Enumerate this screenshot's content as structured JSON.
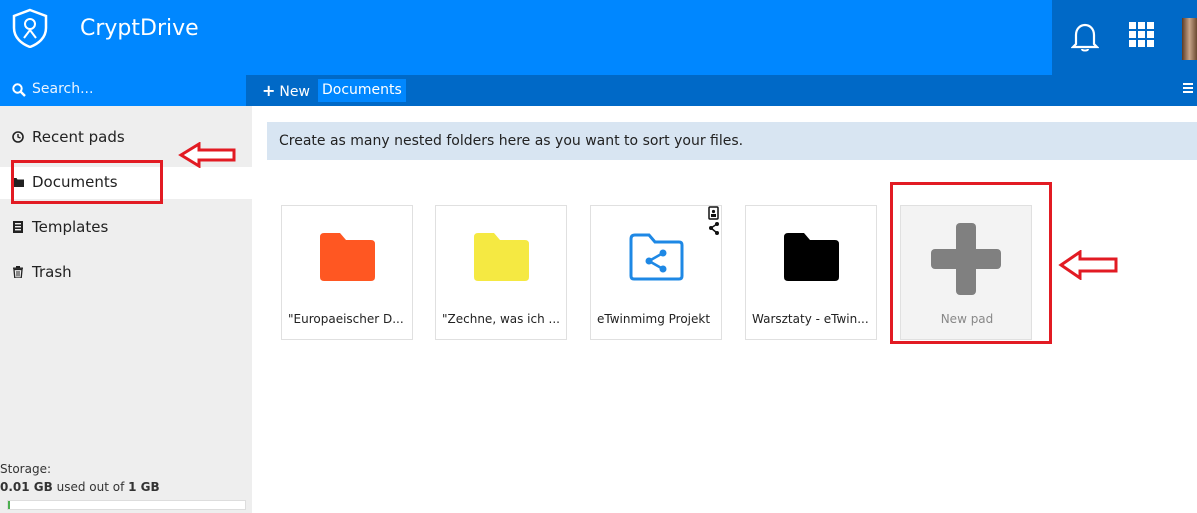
{
  "app": {
    "title": "CryptDrive"
  },
  "search": {
    "placeholder": "Search..."
  },
  "toolbar": {
    "new_label": "New",
    "breadcrumb": "Documents"
  },
  "sidebar": {
    "items": [
      {
        "label": "Recent pads",
        "icon": "clock-icon"
      },
      {
        "label": "Documents",
        "icon": "folder-icon",
        "active": true
      },
      {
        "label": "Templates",
        "icon": "template-icon"
      },
      {
        "label": "Trash",
        "icon": "trash-icon"
      }
    ],
    "storage": {
      "label": "Storage:",
      "used": "0.01 GB",
      "middle": " used out of ",
      "total": "1 GB",
      "fraction": 0.01
    }
  },
  "main": {
    "info": "Create as many nested folders here as you want to sort your files.",
    "tiles": [
      {
        "name": "\"Europaeischer D...",
        "color": "#ff5722",
        "type": "folder"
      },
      {
        "name": "\"Zechne, was ich ...",
        "color": "#f5e942",
        "type": "folder"
      },
      {
        "name": "eTwinmimg Projekt",
        "color": "#1e88e5",
        "type": "shared-folder"
      },
      {
        "name": "Warsztaty - eTwin...",
        "color": "#000000",
        "type": "folder"
      }
    ],
    "new_pad_label": "New pad"
  },
  "colors": {
    "brand": "#0087ff",
    "brand_dark": "#0069c7",
    "annotation": "#e21b23"
  }
}
